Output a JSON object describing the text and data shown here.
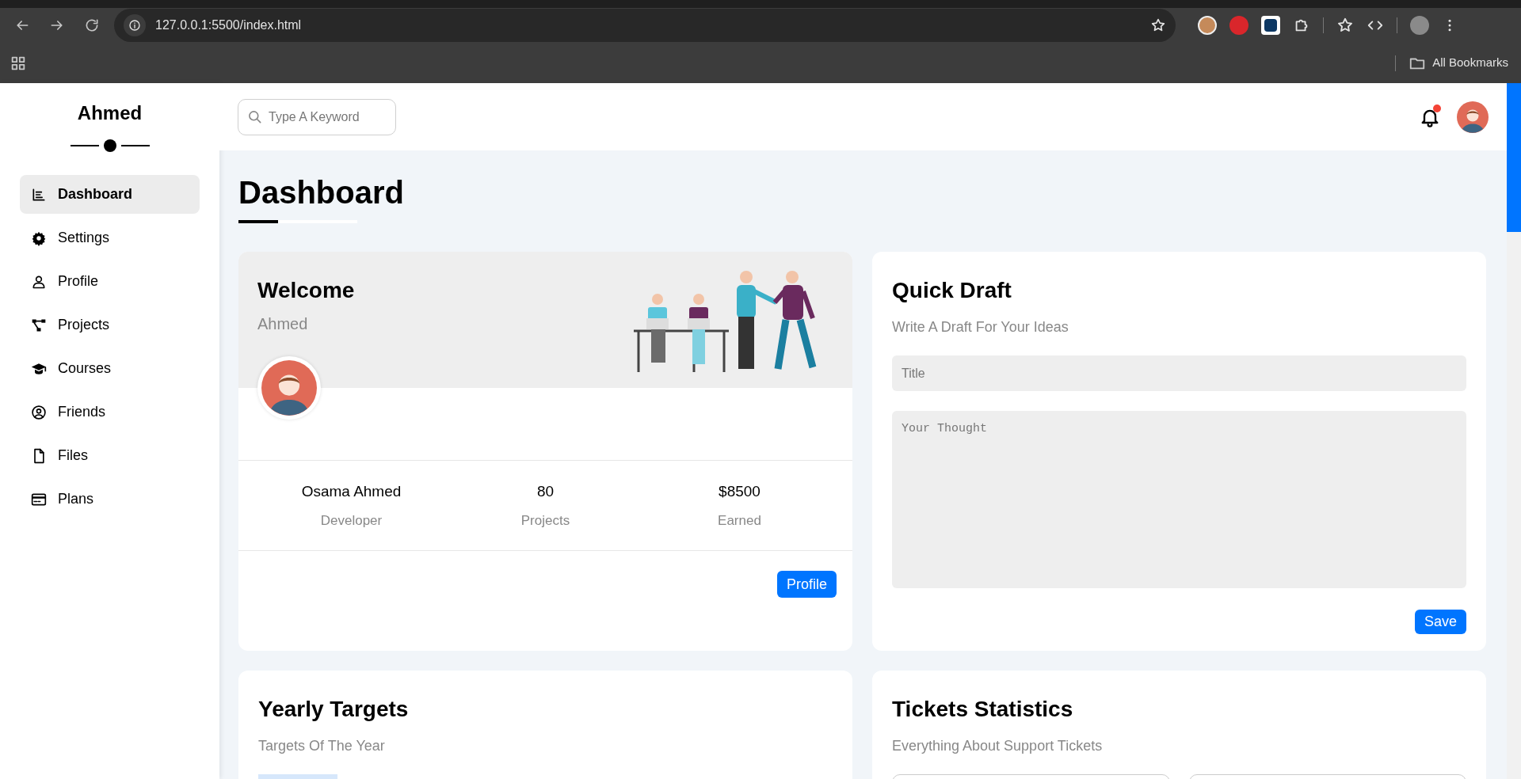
{
  "browser": {
    "url": "127.0.0.1:5500/index.html",
    "bookmarks_label": "All Bookmarks"
  },
  "sidebar": {
    "title": "Ahmed",
    "items": [
      {
        "label": "Dashboard",
        "selected": true
      },
      {
        "label": "Settings",
        "selected": false
      },
      {
        "label": "Profile",
        "selected": false
      },
      {
        "label": "Projects",
        "selected": false
      },
      {
        "label": "Courses",
        "selected": false
      },
      {
        "label": "Friends",
        "selected": false
      },
      {
        "label": "Files",
        "selected": false
      },
      {
        "label": "Plans",
        "selected": false
      }
    ]
  },
  "header": {
    "search": {
      "placeholder": "Type A Keyword"
    },
    "has_notifications": true
  },
  "page_title": "Dashboard",
  "welcome_card": {
    "title": "Welcome",
    "name": "Ahmed",
    "stats": [
      {
        "value": "Osama Ahmed",
        "label": "Developer"
      },
      {
        "value": "80",
        "label": "Projects"
      },
      {
        "value": "$8500",
        "label": "Earned"
      }
    ],
    "button": "Profile"
  },
  "quick_draft": {
    "title": "Quick Draft",
    "subtitle": "Write A Draft For Your Ideas",
    "title_field": {
      "placeholder": "Title"
    },
    "body_field": {
      "placeholder": "Your Thought"
    },
    "button": "Save"
  },
  "yearly_targets": {
    "title": "Yearly Targets",
    "subtitle": "Targets Of The Year"
  },
  "tickets_statistics": {
    "title": "Tickets Statistics",
    "subtitle": "Everything About Support Tickets"
  }
}
